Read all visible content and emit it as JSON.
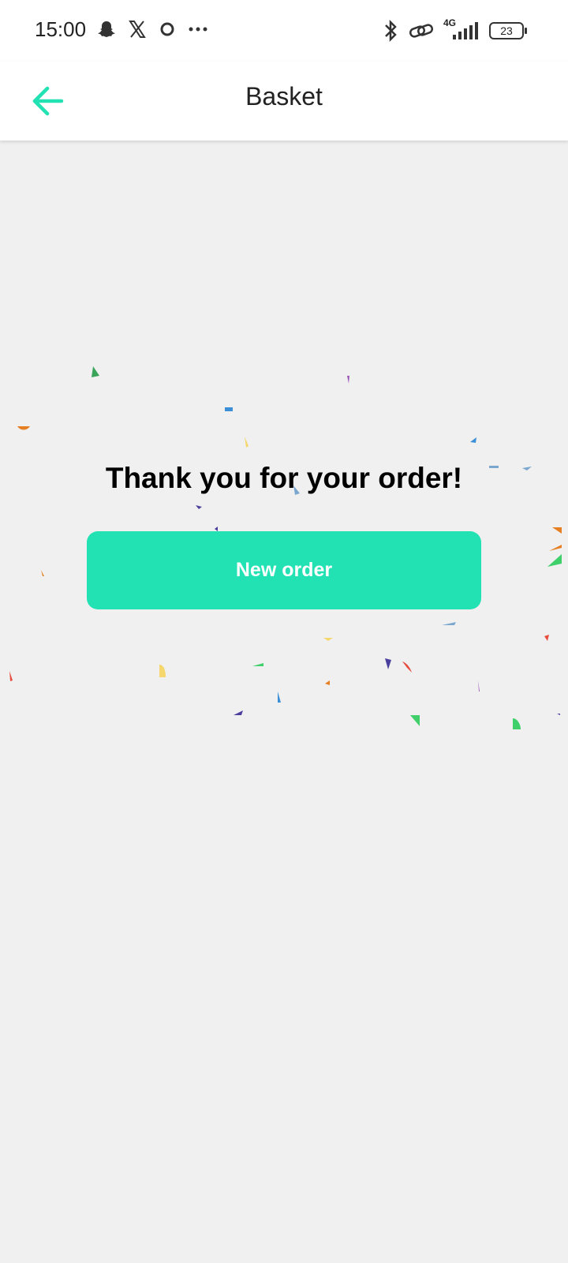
{
  "status_bar": {
    "time": "15:00",
    "left_icons": [
      "snapchat-icon",
      "x-icon",
      "circle-app-icon",
      "more-dots-icon"
    ],
    "right_icons": [
      "bluetooth-icon",
      "link-icon",
      "signal-icon"
    ],
    "network": "4G",
    "battery": "23"
  },
  "app_bar": {
    "title": "Basket",
    "back_icon": "arrow-left-icon"
  },
  "main": {
    "message": "Thank you for your order!",
    "button_label": "New order"
  },
  "colors": {
    "accent": "#22e2b4",
    "background": "#f0f0f0"
  }
}
